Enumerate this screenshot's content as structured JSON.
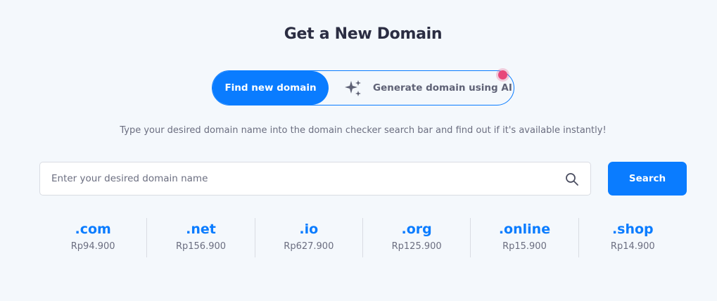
{
  "header": {
    "title": "Get a New Domain"
  },
  "toggle": {
    "find_label": "Find new domain",
    "ai_label": "Generate domain using AI",
    "ai_icon": "sparkles-icon",
    "accent_color": "#0a7cff",
    "dot_color": "#e8477a"
  },
  "description": "Type your desired domain name into the domain checker search bar and find out if it's available instantly!",
  "search": {
    "placeholder": "Enter your desired domain name",
    "value": "",
    "icon": "search-icon",
    "button_label": "Search"
  },
  "tlds": [
    {
      "ext": ".com",
      "price": "Rp94.900"
    },
    {
      "ext": ".net",
      "price": "Rp156.900"
    },
    {
      "ext": ".io",
      "price": "Rp627.900"
    },
    {
      "ext": ".org",
      "price": "Rp125.900"
    },
    {
      "ext": ".online",
      "price": "Rp15.900"
    },
    {
      "ext": ".shop",
      "price": "Rp14.900"
    }
  ]
}
